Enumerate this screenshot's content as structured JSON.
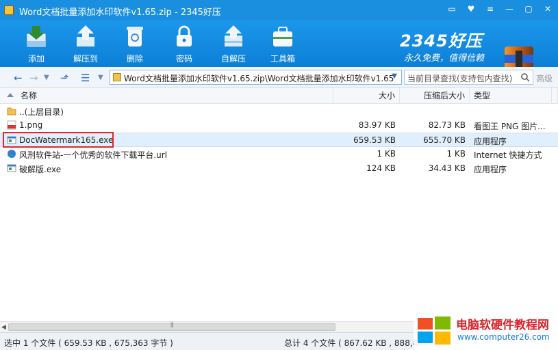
{
  "window": {
    "title": "Word文档批量添加水印软件v1.65.zip - 2345好压"
  },
  "toolbar": {
    "items": [
      {
        "label": "添加"
      },
      {
        "label": "解压到"
      },
      {
        "label": "删除"
      },
      {
        "label": "密码"
      },
      {
        "label": "自解压"
      },
      {
        "label": "工具箱"
      }
    ],
    "logo": "2345好压",
    "slogan": "永久免费，值得信赖"
  },
  "address": {
    "path": "Word文档批量添加水印软件v1.65.zip\\Word文档批量添加水印软件v1.65",
    "search_placeholder": "当前目录查找(支持包内查找)",
    "advanced": "高级"
  },
  "columns": {
    "name": "名称",
    "size": "大小",
    "compressed": "压缩后大小",
    "type": "类型"
  },
  "files": [
    {
      "name": "..(上层目录)",
      "size": "",
      "compressed": "",
      "type": "",
      "icon": "folder-up-icon"
    },
    {
      "name": "1.png",
      "size": "83.97 KB",
      "compressed": "82.73 KB",
      "type": "看图王 PNG 图片...",
      "icon": "png-file-icon"
    },
    {
      "name": "DocWatermark165.exe",
      "size": "659.53 KB",
      "compressed": "655.70 KB",
      "type": "应用程序",
      "icon": "exe-file-icon"
    },
    {
      "name": "风刑软件站-一个优秀的软件下载平台.url",
      "size": "1 KB",
      "compressed": "1 KB",
      "type": "Internet 快捷方式",
      "icon": "globe-icon"
    },
    {
      "name": "破解版.exe",
      "size": "124 KB",
      "compressed": "34.43 KB",
      "type": "应用程序",
      "icon": "exe-file-icon"
    }
  ],
  "status": {
    "selection": "选中 1 个文件 ( 659.53 KB , 675,363 字节 )",
    "total": "总计 4 个文件 ( 867.62 KB , 888,446 字节 )"
  },
  "watermark": {
    "title": "电脑软硬件教程网",
    "url": "www.computer26.com"
  },
  "colors": {
    "titlebar": "#1a8fe0",
    "selection": "#e1eefb",
    "highlight_box": "#e0262b"
  }
}
